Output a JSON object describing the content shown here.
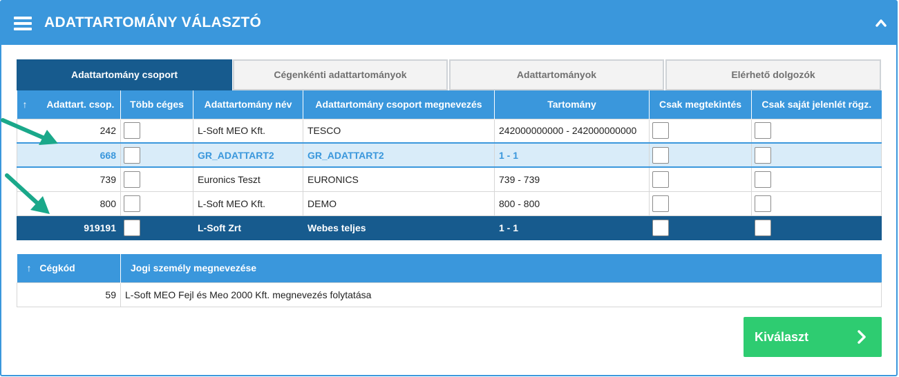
{
  "header": {
    "title": "ADATTARTOMÁNY VÁLASZTÓ"
  },
  "tabs": [
    {
      "label": "Adattartomány csoport",
      "active": true
    },
    {
      "label": "Cégenkénti adattartományok",
      "active": false
    },
    {
      "label": "Adattartományok",
      "active": false
    },
    {
      "label": "Elérhető dolgozók",
      "active": false
    }
  ],
  "grid1": {
    "sort_arrow": "↑",
    "columns": [
      "Adattart. csop.",
      "Több céges",
      "Adattartomány név",
      "Adattartomány csoport megnevezés",
      "Tartomány",
      "Csak megtekintés",
      "Csak saját jelenlét rögz."
    ],
    "rows": [
      {
        "id": "242",
        "name": "L-Soft MEO Kft.",
        "group": "TESCO",
        "range": "242000000000 - 242000000000"
      },
      {
        "id": "668",
        "name": "GR_ADATTART2",
        "group": "GR_ADATTART2",
        "range": "1 - 1"
      },
      {
        "id": "739",
        "name": "Euronics Teszt",
        "group": "EURONICS",
        "range": "739 - 739"
      },
      {
        "id": "800",
        "name": "L-Soft MEO Kft.",
        "group": "DEMO",
        "range": "800 - 800"
      },
      {
        "id": "919191",
        "name": "L-Soft Zrt",
        "group": "Webes teljes",
        "range": "1 - 1"
      }
    ]
  },
  "grid2": {
    "sort_arrow": "↑",
    "columns": [
      "Cégkód",
      "Jogi személy megnevezése"
    ],
    "rows": [
      {
        "code": "59",
        "name": "L-Soft MEO Fejl és Meo 2000 Kft. megnevezés folytatása"
      }
    ]
  },
  "buttons": {
    "select_label": "Kiválaszt"
  },
  "colors": {
    "header": "#3a97dc",
    "active_tab": "#175b8e",
    "select_button": "#2ecc71",
    "annotation_arrow": "#1aa88a"
  }
}
